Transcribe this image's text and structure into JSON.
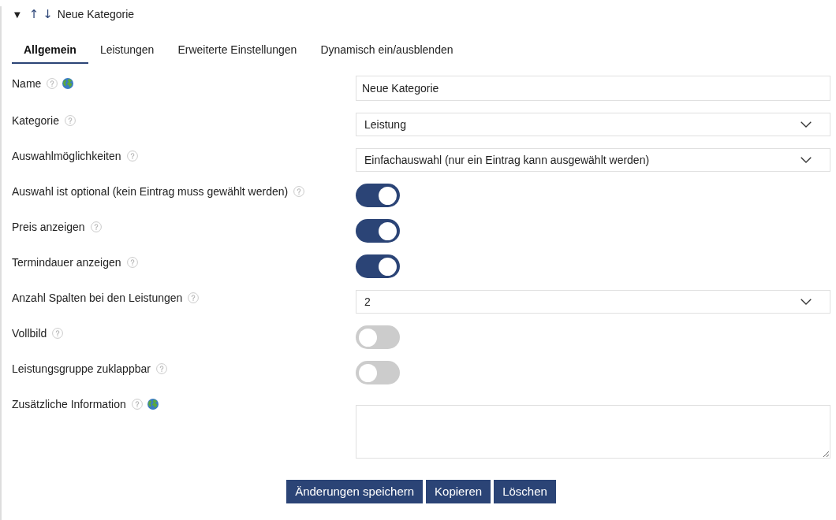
{
  "header": {
    "collapse": "▼",
    "move_up": "↑",
    "move_down": "↓",
    "title": "Neue Kategorie"
  },
  "tabs": [
    {
      "label": "Allgemein",
      "selected": true
    },
    {
      "label": "Leistungen",
      "selected": false
    },
    {
      "label": "Erweiterte Einstellungen",
      "selected": false
    },
    {
      "label": "Dynamisch ein/ausblenden",
      "selected": false
    }
  ],
  "fields": [
    {
      "label": "Name",
      "kind": "text",
      "translatable": true,
      "value": "Neue Kategorie"
    },
    {
      "label": "Kategorie",
      "kind": "select",
      "translatable": false,
      "value": "Leistung"
    },
    {
      "label": "Auswahlmöglichkeiten",
      "kind": "select",
      "translatable": false,
      "value": "Einfachauswahl (nur ein Eintrag kann ausgewählt werden)"
    },
    {
      "label": "Auswahl ist optional (kein Eintrag muss gewählt werden)",
      "kind": "toggle",
      "translatable": false,
      "on": true
    },
    {
      "label": "Preis anzeigen",
      "kind": "toggle",
      "translatable": false,
      "on": true
    },
    {
      "label": "Termindauer anzeigen",
      "kind": "toggle",
      "translatable": false,
      "on": true
    },
    {
      "label": "Anzahl Spalten bei den Leistungen",
      "kind": "select",
      "translatable": false,
      "value": "2"
    },
    {
      "label": "Vollbild",
      "kind": "toggle",
      "translatable": false,
      "on": false
    },
    {
      "label": "Leistungsgruppe zuklappbar",
      "kind": "toggle",
      "translatable": false,
      "on": false
    },
    {
      "label": "Zusätzliche Information",
      "kind": "textarea",
      "translatable": true
    }
  ],
  "buttons": [
    "Änderungen speichern",
    "Kopieren",
    "Löschen"
  ]
}
